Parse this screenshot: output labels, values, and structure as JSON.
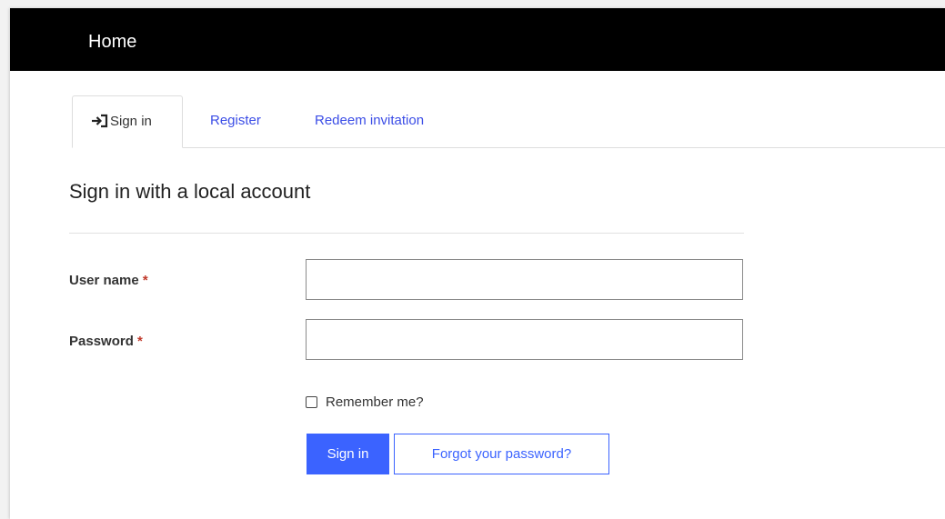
{
  "navbar": {
    "brand": "Home"
  },
  "tabs": [
    {
      "label": "Sign in",
      "icon": "sign-in-icon",
      "active": true
    },
    {
      "label": "Register",
      "active": false
    },
    {
      "label": "Redeem invitation",
      "active": false
    }
  ],
  "form": {
    "heading": "Sign in with a local account",
    "username": {
      "label": "User name",
      "required_marker": "*",
      "value": ""
    },
    "password": {
      "label": "Password",
      "required_marker": "*",
      "value": ""
    },
    "remember_label": "Remember me?",
    "remember_checked": false,
    "submit_label": "Sign in",
    "forgot_label": "Forgot your password?"
  },
  "colors": {
    "navbar_bg": "#000000",
    "link": "#3b4de6",
    "primary": "#3b63ff",
    "required": "#c0392b"
  }
}
